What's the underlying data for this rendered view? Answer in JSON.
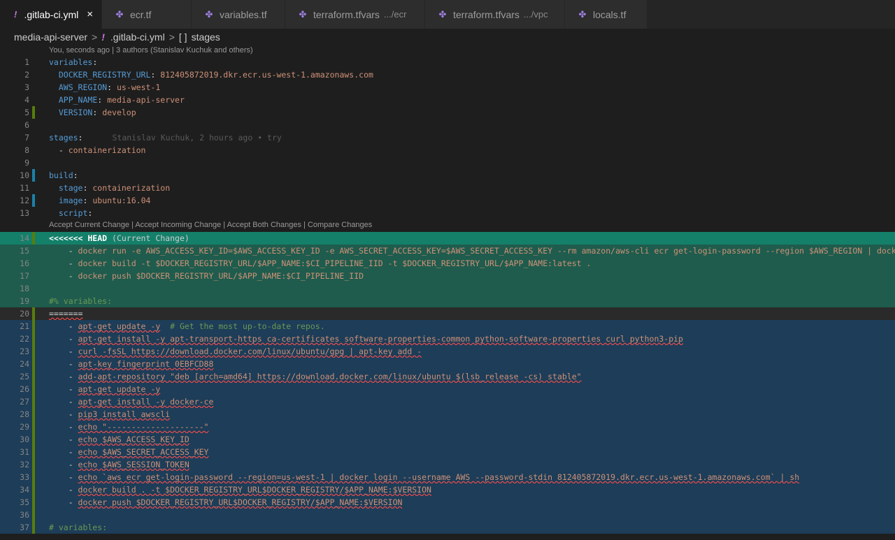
{
  "tabs": [
    {
      "label": ".gitlab-ci.yml",
      "icon": "yaml-file-icon",
      "active": true,
      "desc": ""
    },
    {
      "label": "ecr.tf",
      "icon": "terraform-file-icon",
      "active": false,
      "desc": ""
    },
    {
      "label": "variables.tf",
      "icon": "terraform-file-icon",
      "active": false,
      "desc": ""
    },
    {
      "label": "terraform.tfvars",
      "icon": "terraform-file-icon",
      "active": false,
      "desc": ".../ecr"
    },
    {
      "label": "terraform.tfvars",
      "icon": "terraform-file-icon",
      "active": false,
      "desc": ".../vpc"
    },
    {
      "label": "locals.tf",
      "icon": "terraform-file-icon",
      "active": false,
      "desc": ""
    }
  ],
  "breadcrumb": {
    "project": "media-api-server",
    "file": ".gitlab-ci.yml",
    "symbol": "stages"
  },
  "blame_lens": "You, seconds ago | 3 authors (Stanislav Kuchuk and others)",
  "merge_lens": "Accept Current Change | Accept Incoming Change | Accept Both Changes | Compare Changes",
  "inline_blame": "Stanislav Kuchuk, 2 hours ago • try",
  "colors": {
    "current_change": "#1f5c4d",
    "incoming_change": "#1d3d58",
    "modified_gutter": "#587c0c",
    "added_gutter": "#1b81a8"
  },
  "lines": [
    {
      "n": "1",
      "parts": [
        [
          "k",
          "variables"
        ],
        [
          "w",
          ":"
        ]
      ]
    },
    {
      "n": "2",
      "parts": [
        [
          "w",
          "  "
        ],
        [
          "k",
          "DOCKER_REGISTRY_URL"
        ],
        [
          "w",
          ": "
        ],
        [
          "s",
          "812405872019.dkr.ecr.us-west-1.amazonaws.com"
        ]
      ]
    },
    {
      "n": "3",
      "parts": [
        [
          "w",
          "  "
        ],
        [
          "k",
          "AWS_REGION"
        ],
        [
          "w",
          ": "
        ],
        [
          "s",
          "us-west-1"
        ]
      ]
    },
    {
      "n": "4",
      "parts": [
        [
          "w",
          "  "
        ],
        [
          "k",
          "APP_NAME"
        ],
        [
          "w",
          ": "
        ],
        [
          "s",
          "media-api-server"
        ]
      ]
    },
    {
      "n": "5",
      "parts": [
        [
          "w",
          "  "
        ],
        [
          "k",
          "VERSION"
        ],
        [
          "w",
          ": "
        ],
        [
          "s",
          "develop"
        ]
      ]
    },
    {
      "n": "6",
      "parts": []
    },
    {
      "n": "7",
      "parts": [
        [
          "k",
          "stages"
        ],
        [
          "w",
          ":"
        ]
      ]
    },
    {
      "n": "8",
      "parts": [
        [
          "w",
          "  - "
        ],
        [
          "s",
          "containerization"
        ]
      ]
    },
    {
      "n": "9",
      "parts": []
    },
    {
      "n": "10",
      "parts": [
        [
          "k",
          "build"
        ],
        [
          "w",
          ":"
        ]
      ]
    },
    {
      "n": "11",
      "parts": [
        [
          "w",
          "  "
        ],
        [
          "k",
          "stage"
        ],
        [
          "w",
          ": "
        ],
        [
          "s",
          "containerization"
        ]
      ]
    },
    {
      "n": "12",
      "parts": [
        [
          "w",
          "  "
        ],
        [
          "k",
          "image"
        ],
        [
          "w",
          ": "
        ],
        [
          "s",
          "ubuntu:16.04"
        ]
      ]
    },
    {
      "n": "13",
      "parts": [
        [
          "w",
          "  "
        ],
        [
          "k",
          "script"
        ],
        [
          "w",
          ":"
        ]
      ]
    },
    {
      "n": "14",
      "parts": [
        [
          "hdr",
          "<<<<<<< HEAD"
        ],
        [
          "hdrtag",
          " (Current Change)"
        ]
      ]
    },
    {
      "n": "15",
      "parts": [
        [
          "w",
          "    - "
        ],
        [
          "s",
          "docker run -e AWS_ACCESS_KEY_ID=$AWS_ACCESS_KEY_ID -e AWS_SECRET_ACCESS_KEY=$AWS_SECRET_ACCESS_KEY --rm amazon/aws-cli ecr get-login-password --region $AWS_REGION | docker login --username AWS"
        ]
      ]
    },
    {
      "n": "16",
      "parts": [
        [
          "w",
          "    - "
        ],
        [
          "s",
          "docker build -t $DOCKER_REGISTRY_URL/$APP_NAME:$CI_PIPELINE_IID -t $DOCKER_REGISTRY_URL/$APP_NAME:latest ."
        ]
      ]
    },
    {
      "n": "17",
      "parts": [
        [
          "w",
          "    - "
        ],
        [
          "s",
          "docker push $DOCKER_REGISTRY_URL/$APP_NAME:$CI_PIPELINE_IID"
        ]
      ]
    },
    {
      "n": "18",
      "parts": []
    },
    {
      "n": "19",
      "parts": [
        [
          "c",
          "#% variables:"
        ]
      ]
    },
    {
      "n": "20",
      "parts": [
        [
          "w",
          "======="
        ]
      ]
    },
    {
      "n": "21",
      "parts": [
        [
          "w",
          "    - "
        ],
        [
          "s",
          "apt-get update -y"
        ],
        [
          "c",
          "  # Get the most up-to-date repos."
        ]
      ]
    },
    {
      "n": "22",
      "parts": [
        [
          "w",
          "    - "
        ],
        [
          "s",
          "apt-get install -y apt-transport-https ca-certificates software-properties-common python-software-properties curl python3-pip"
        ]
      ]
    },
    {
      "n": "23",
      "parts": [
        [
          "w",
          "    - "
        ],
        [
          "s",
          "curl -fsSL https://download.docker.com/linux/ubuntu/gpg | apt-key add -"
        ]
      ]
    },
    {
      "n": "24",
      "parts": [
        [
          "w",
          "    - "
        ],
        [
          "s",
          "apt-key fingerprint 0EBFCD88"
        ]
      ]
    },
    {
      "n": "25",
      "parts": [
        [
          "w",
          "    - "
        ],
        [
          "s",
          "add-apt-repository \"deb [arch=amd64] https://download.docker.com/linux/ubuntu $(lsb_release -cs) stable\""
        ]
      ]
    },
    {
      "n": "26",
      "parts": [
        [
          "w",
          "    - "
        ],
        [
          "s",
          "apt-get update -y"
        ]
      ]
    },
    {
      "n": "27",
      "parts": [
        [
          "w",
          "    - "
        ],
        [
          "s",
          "apt-get install -y docker-ce"
        ]
      ]
    },
    {
      "n": "28",
      "parts": [
        [
          "w",
          "    - "
        ],
        [
          "s",
          "pip3 install awscli"
        ]
      ]
    },
    {
      "n": "29",
      "parts": [
        [
          "w",
          "    - "
        ],
        [
          "s",
          "echo \"--------------------\""
        ]
      ]
    },
    {
      "n": "30",
      "parts": [
        [
          "w",
          "    - "
        ],
        [
          "s",
          "echo $AWS_ACCESS_KEY_ID"
        ]
      ]
    },
    {
      "n": "31",
      "parts": [
        [
          "w",
          "    - "
        ],
        [
          "s",
          "echo $AWS_SECRET_ACCESS_KEY"
        ]
      ]
    },
    {
      "n": "32",
      "parts": [
        [
          "w",
          "    - "
        ],
        [
          "s",
          "echo $AWS_SESSION_TOKEN"
        ]
      ]
    },
    {
      "n": "33",
      "parts": [
        [
          "w",
          "    - "
        ],
        [
          "s",
          "echo `aws ecr get-login-password --region=us-west-1 | docker login --username AWS --password-stdin 812405872019.dkr.ecr.us-west-1.amazonaws.com` | sh"
        ]
      ]
    },
    {
      "n": "34",
      "parts": [
        [
          "w",
          "    - "
        ],
        [
          "s",
          "docker build . -t $DOCKER_REGISTRY_URL$DOCKER_REGISTRY/$APP_NAME:$VERSION"
        ]
      ]
    },
    {
      "n": "35",
      "parts": [
        [
          "w",
          "    - "
        ],
        [
          "s",
          "docker push $DOCKER_REGISTRY_URL$DOCKER_REGISTRY/$APP_NAME:$VERSION"
        ]
      ]
    },
    {
      "n": "36",
      "parts": []
    },
    {
      "n": "37",
      "parts": [
        [
          "c",
          "# variables:"
        ]
      ]
    }
  ]
}
